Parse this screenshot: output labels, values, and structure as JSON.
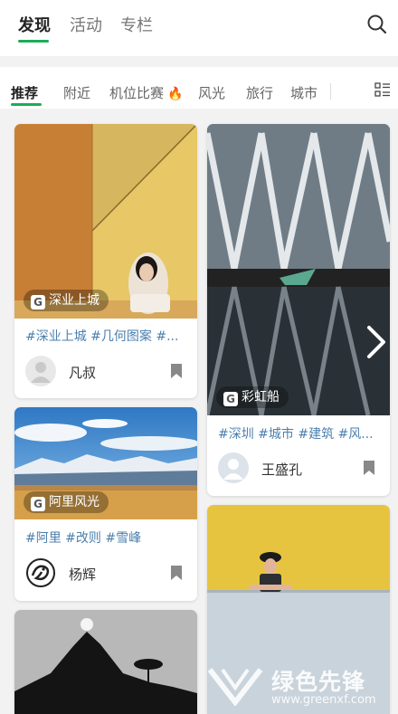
{
  "header": {
    "tabs": [
      "发现",
      "活动",
      "专栏"
    ]
  },
  "categories": {
    "items": [
      "推荐",
      "附近",
      "机位比赛",
      "风光",
      "旅行",
      "城市"
    ]
  },
  "feed": {
    "cards": [
      {
        "location": "深业上城",
        "tags": "#深业上城 #几何图案 #...",
        "author": "凡叔"
      },
      {
        "location": "彩虹船",
        "tags": "#深圳 #城市 #建筑 #风...",
        "author": "王盛孔"
      },
      {
        "location": "阿里风光",
        "tags": "#阿里 #改则 #雪峰",
        "author": "杨辉"
      }
    ]
  },
  "watermark": {
    "brand": "绿色先锋",
    "url": "www.greenxf.com"
  },
  "icons": {
    "search": "search-icon",
    "grid": "grid-menu-icon",
    "fire": "fire-icon",
    "bookmark": "bookmark-icon",
    "prev": "chevron-left-icon",
    "next": "chevron-right-icon"
  },
  "colors": {
    "accent": "#1aad5a",
    "tag": "#4b7fae",
    "fire": "#f04e2a"
  }
}
